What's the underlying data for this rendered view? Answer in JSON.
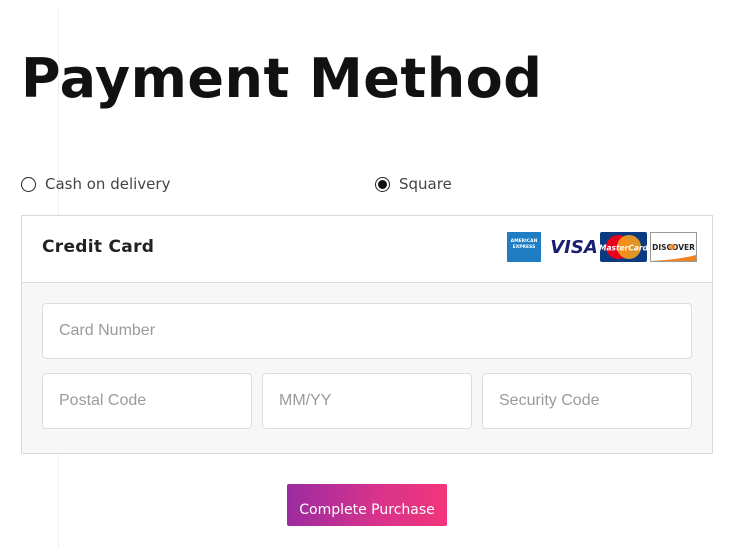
{
  "page": {
    "title": "Payment Method"
  },
  "payment_options": [
    {
      "label": "Cash on delivery",
      "selected": false
    },
    {
      "label": "Square",
      "selected": true
    }
  ],
  "credit_card": {
    "title": "Credit Card",
    "logos": {
      "amex_text": "AMERICAN EXPRESS",
      "visa_text": "VISA",
      "mastercard_text": "MasterCard",
      "discover_text": "DISCOVER"
    },
    "fields": {
      "card_number_placeholder": "Card Number",
      "postal_code_placeholder": "Postal Code",
      "expiry_placeholder": "MM/YY",
      "security_code_placeholder": "Security Code"
    }
  },
  "actions": {
    "complete_purchase_label": "Complete Purchase"
  },
  "colors": {
    "button_gradient_start": "#9b2ba0",
    "button_gradient_end": "#f3357a",
    "visa_blue": "#1a1f71",
    "amex_blue": "#1e7dc3",
    "mastercard_red": "#eb001b",
    "mastercard_orange": "#f79e1b",
    "discover_orange": "#f58220"
  }
}
